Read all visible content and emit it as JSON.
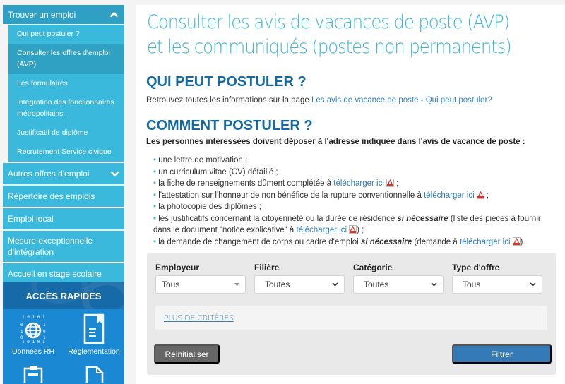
{
  "sidebar": {
    "top": {
      "label": "Trouver un emploi",
      "expanded": true
    },
    "sub_items": [
      {
        "label": "Qui peut postuler ?"
      },
      {
        "label": "Consulter les offres d'emploi (AVP)",
        "active": true
      },
      {
        "label": "Les formulaires"
      },
      {
        "label": "Intégration des fonctionnaires métropolitains"
      },
      {
        "label": "Justificatif de diplôme"
      },
      {
        "label": "Recrutement Service civique"
      }
    ],
    "items": [
      {
        "label": "Autres offres d'emploi",
        "expandable": true
      },
      {
        "label": "Répertoire des emplois"
      },
      {
        "label": "Emploi local"
      },
      {
        "label": "Mesure exceptionnelle d'intégration"
      },
      {
        "label": "Accueil en stage scolaire"
      }
    ]
  },
  "quick_access": {
    "title": "ACCÈS RAPIDES",
    "items": [
      {
        "label": "Données RH",
        "icon": "globe-data-icon"
      },
      {
        "label": "Réglementation",
        "icon": "book-icon"
      },
      {
        "label": "",
        "icon": "clipboard-icon"
      },
      {
        "label": "",
        "icon": "document-icon"
      }
    ]
  },
  "main": {
    "title": "Consulter les avis de vacances de poste (AVP) et les communiqués (postes non permanents)",
    "section1": {
      "heading": "QUI PEUT POSTULER ?",
      "text": "Retrouvez toutes les informations sur la page ",
      "link": "Les avis de vacance de poste - Qui peut postuler?"
    },
    "section2": {
      "heading": "COMMENT POSTULER ?",
      "intro": "Les personnes intéressées doivent déposer à l'adresse indiquée dans l'avis de vacance de poste :",
      "bullet": "•",
      "download_label": "télécharger ici",
      "items": [
        {
          "text": "une lettre de motivation ;"
        },
        {
          "text": "un curriculum vitae (CV) détaillé ;"
        },
        {
          "text": "la fiche de renseignements dûment complétée à ",
          "after": " ;"
        },
        {
          "text": "l'attestation sur l'honneur de non bénéfice de la rupture conventionnelle à ",
          "after": " ;"
        },
        {
          "text": "la photocopie des diplômes ;"
        },
        {
          "text": "les justificatifs concernant la citoyenneté ou la durée de résidence ",
          "emph": "si nécessaire",
          "text2": " (liste des pièces à fournir dans le document \"notice explicative\" à ",
          "after": ") ;"
        },
        {
          "text": "la demande de changement de corps ou cadre d'emploi ",
          "emph": "si nécessaire",
          "text2": " (demande à ",
          "after": ")."
        }
      ]
    }
  },
  "filters": {
    "fields": [
      {
        "label": "Employeur",
        "value": "Tous"
      },
      {
        "label": "Filière",
        "value": "Toutes"
      },
      {
        "label": "Catégorie",
        "value": "Toutes"
      },
      {
        "label": "Type d'offre",
        "value": "Tous"
      }
    ],
    "more_criteria": "PLUS DE CRITÈRES",
    "reset_label": "Réinitialiser",
    "submit_label": "Filtrer"
  },
  "colors": {
    "accent": "#3ab9dd",
    "accent_dark": "#2fa0c3",
    "heading": "#146aa3",
    "link": "#2f7fc2",
    "primary_button": "#337ab7",
    "secondary_button": "#666666",
    "quick_access_bg": "#1a88d2"
  }
}
